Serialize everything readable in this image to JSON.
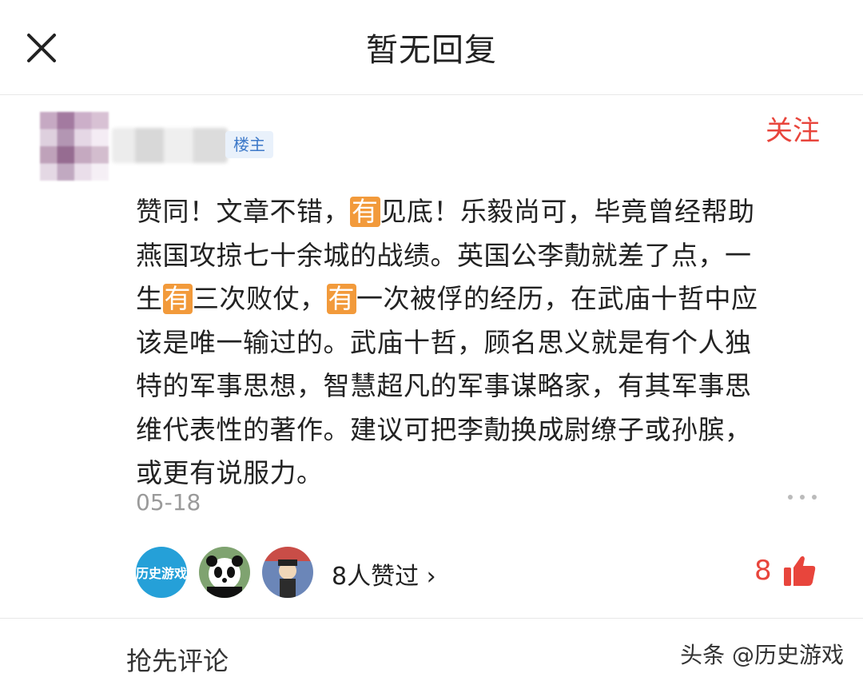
{
  "header": {
    "title": "暂无回复"
  },
  "post": {
    "owner_badge": "楼主",
    "follow_label": "关注",
    "text_lines": [
      [
        "赞同！文章不错，",
        "有",
        "见底！乐毅尚可，毕竟曾经帮助"
      ],
      [
        "燕国攻掠七十余城的战绩。英国公李勣就差了点，一"
      ],
      [
        "生",
        "有",
        "三次败仗，",
        "有",
        "一次被俘的经历，在武庙十哲中应"
      ],
      [
        "该是唯一输过的。武庙十哲，顾名思义就是有个人独"
      ],
      [
        "特的军事思想，智慧超凡的军事谋略家，有其军事思"
      ],
      [
        "维代表性的著作。建议可把李勣换成尉缭子或孙膑，"
      ],
      [
        "或更有说服力。"
      ]
    ],
    "date": "05-18",
    "liker_avatar_1_text": "历史游戏",
    "liked_by": "8人赞过 ›",
    "like_count": "8"
  },
  "footer": {
    "comment_first": "抢先评论",
    "watermark": "头条 @历史游戏"
  },
  "colors": {
    "accent": "#e8453c",
    "highlight": "#f29a3b",
    "badge_bg": "#e9f1fb",
    "badge_text": "#3d79c9"
  },
  "icons": {
    "close": "close-icon",
    "more": "more-dots-icon",
    "like": "thumbs-up-icon"
  }
}
